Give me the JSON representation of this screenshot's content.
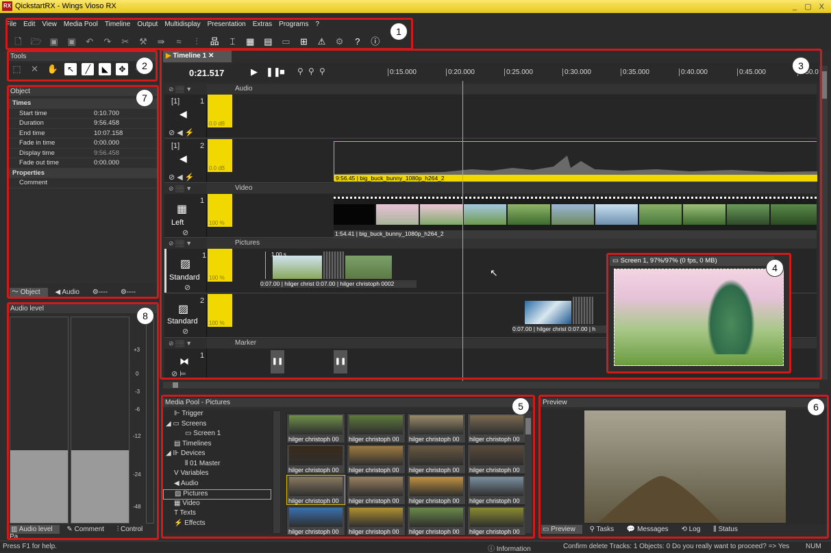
{
  "window": {
    "title": "QickstartRX - Wings Vioso RX",
    "controls": "_ ▢ X"
  },
  "menu": [
    "File",
    "Edit",
    "View",
    "Media Pool",
    "Timeline",
    "Output",
    "Multidisplay",
    "Presentation",
    "Extras",
    "Programs",
    "?"
  ],
  "callouts": [
    "1",
    "2",
    "3",
    "4",
    "5",
    "6",
    "7",
    "8"
  ],
  "tools_panel": {
    "title": "Tools"
  },
  "object_panel": {
    "title": "Object",
    "sections": [
      {
        "name": "Times",
        "rows": [
          {
            "k": "Start time",
            "v": "0:10.700"
          },
          {
            "k": "Duration",
            "v": "9:56.458"
          },
          {
            "k": "End time",
            "v": "10:07.158"
          },
          {
            "k": "Fade in time",
            "v": "0:00.000"
          },
          {
            "k": "Display time",
            "v": "9:56.458"
          },
          {
            "k": "Fade out time",
            "v": "0:00.000"
          }
        ]
      },
      {
        "name": "Properties",
        "rows": [
          {
            "k": "Comment",
            "v": ""
          }
        ]
      }
    ],
    "tabs": [
      "Object",
      "Audio",
      "----",
      "----"
    ]
  },
  "audio_level": {
    "title": "Audio level",
    "scale": [
      "+3",
      "0",
      "-3",
      "-6",
      "-12",
      "-24",
      "-48"
    ],
    "tabs": [
      "Audio level",
      "Comment",
      "Control Pa..."
    ]
  },
  "timeline": {
    "tab": "Timeline 1",
    "time": "0:21.517",
    "ruler": [
      "0:15.000",
      "0:20.000",
      "0:25.000",
      "0:30.000",
      "0:35.000",
      "0:40.000",
      "0:45.000",
      "0:50.0"
    ],
    "groups": {
      "audio": "Audio",
      "video": "Video",
      "pictures": "Pictures",
      "marker": "Marker"
    },
    "tracks": {
      "a1": {
        "num": "1",
        "tag": "[1]",
        "level": "0.0 dB"
      },
      "a2": {
        "num": "2",
        "tag": "[1]",
        "level": "0.0 dB",
        "clip": "9:56.45 | big_buck_bunny_1080p_h264_2"
      },
      "v1": {
        "num": "1",
        "name": "Left",
        "level": "100 %",
        "clip": "1:54.41 | big_buck_bunny_1080p_h264_2"
      },
      "p1": {
        "num": "1",
        "name": "Standard",
        "level": "100 %",
        "clip1": "0:07.00 | hilger christ",
        "clip2": "0:07.00 | hilger christoph 0002",
        "badge": "1.00 s"
      },
      "p2": {
        "num": "2",
        "name": "Standard",
        "level": "100 %",
        "clip1": "0:07.00 | hilger christ",
        "clip2": "0:07.00 | h"
      },
      "m1": {
        "num": "1"
      }
    }
  },
  "screen_preview": {
    "title": "Screen 1, 97%/97% (0 fps, 0 MB)"
  },
  "media_pool": {
    "title": "Media Pool - Pictures",
    "tree": [
      "Trigger",
      "Screens",
      "Screen 1",
      "Timelines",
      "Devices",
      "01 Master",
      "Variables",
      "Audio",
      "Pictures",
      "Video",
      "Texts",
      "Effects"
    ],
    "thumb_caption": "hilger christoph 00"
  },
  "preview": {
    "title": "Preview",
    "tabs": [
      "Preview",
      "Tasks",
      "Messages",
      "Log",
      "Status"
    ]
  },
  "statusbar": {
    "left": "Press F1 for help.",
    "info": "Information",
    "message": "Confirm delete Tracks: 1 Objects: 0 Do you really want to proceed? => Yes",
    "num": "NUM"
  }
}
